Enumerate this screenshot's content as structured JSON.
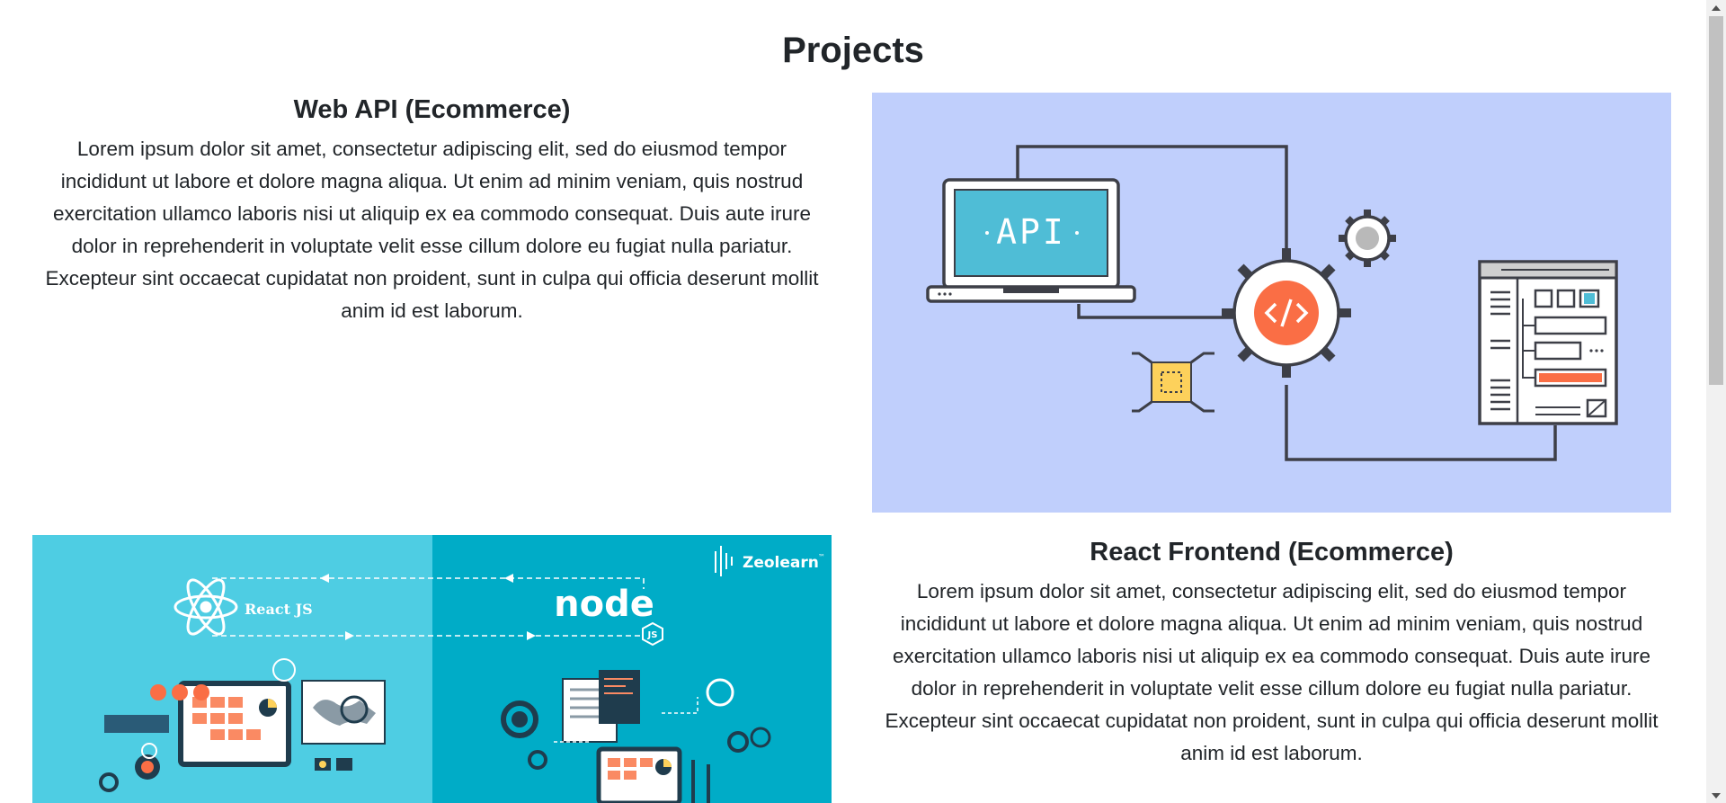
{
  "page": {
    "title": "Projects"
  },
  "projects": [
    {
      "title": "Web API (Ecommerce)",
      "description": "Lorem ipsum dolor sit amet, consectetur adipiscing elit, sed do eiusmod tempor incididunt ut labore et dolore magna aliqua. Ut enim ad minim veniam, quis nostrud exercitation ullamco laboris nisi ut aliquip ex ea commodo consequat. Duis aute irure dolor in reprehenderit in voluptate velit esse cillum dolore eu fugiat nulla pariatur. Excepteur sint occaecat cupidatat non proident, sunt in culpa qui officia deserunt mollit anim id est laborum.",
      "image": {
        "screen_text": "API",
        "background_color": "#c0cffc"
      }
    },
    {
      "title": "React Frontend (Ecommerce)",
      "description": "Lorem ipsum dolor sit amet, consectetur adipiscing elit, sed do eiusmod tempor incididunt ut labore et dolore magna aliqua. Ut enim ad minim veniam, quis nostrud exercitation ullamco laboris nisi ut aliquip ex ea commodo consequat. Duis aute irure dolor in reprehenderit in voluptate velit esse cillum dolore eu fugiat nulla pariatur. Excepteur sint occaecat cupidatat non proident, sunt in culpa qui officia deserunt mollit anim id est laborum.",
      "image": {
        "brand_text": "Zeolearn",
        "brand_mark": "™",
        "react_text": "React JS",
        "node_text": "node",
        "node_badge": "JS"
      }
    }
  ],
  "colors": {
    "accent_orange": "#fa6e45",
    "accent_teal": "#4fbdd6",
    "accent_yellow": "#fdd15b"
  }
}
